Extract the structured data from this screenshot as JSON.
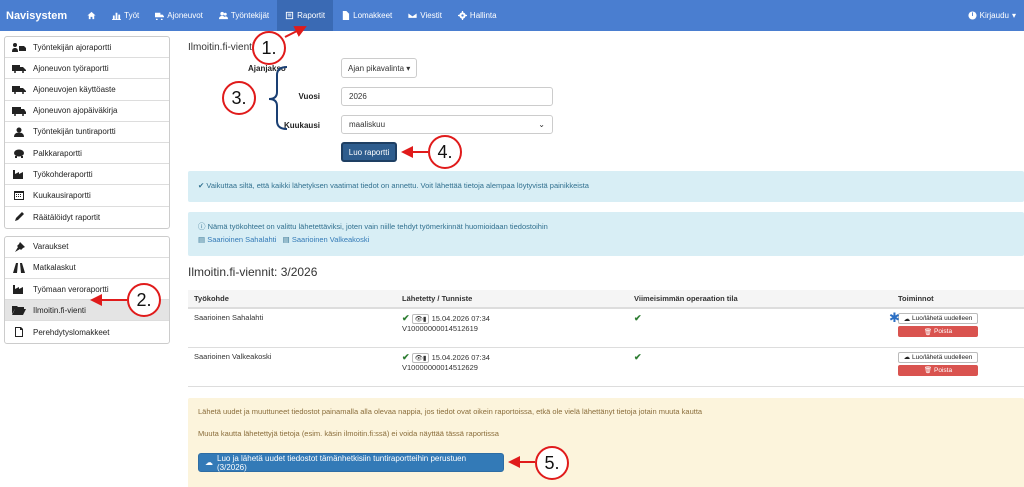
{
  "navbar": {
    "brand": "Navisystem",
    "items": [
      {
        "label": "",
        "icon": "home-icon"
      },
      {
        "label": "Työt",
        "icon": "bar-chart-icon"
      },
      {
        "label": "Ajoneuvot",
        "icon": "truck-icon"
      },
      {
        "label": "Työntekijät",
        "icon": "users-icon"
      },
      {
        "label": "Raportit",
        "icon": "report-icon",
        "active": true
      },
      {
        "label": "Lomakkeet",
        "icon": "file-icon"
      },
      {
        "label": "Viestit",
        "icon": "envelope-icon"
      },
      {
        "label": "Hallinta",
        "icon": "gear-icon"
      }
    ],
    "logout": "Kirjaudu"
  },
  "sidebar": {
    "group1": [
      {
        "label": "Työntekijän ajoraportti",
        "icon": "user-car-icon"
      },
      {
        "label": "Ajoneuvon työraportti",
        "icon": "truck-icon"
      },
      {
        "label": "Ajoneuvojen käyttöaste",
        "icon": "truck-icon"
      },
      {
        "label": "Ajoneuvon ajopäiväkirja",
        "icon": "truck-icon"
      },
      {
        "label": "Työntekijän tuntiraportti",
        "icon": "user-icon"
      },
      {
        "label": "Palkkaraportti",
        "icon": "piggy-bank-icon"
      },
      {
        "label": "Työkohderaportti",
        "icon": "factory-icon"
      },
      {
        "label": "Kuukausiraportti",
        "icon": "calendar-icon"
      },
      {
        "label": "Räätälöidyt raportit",
        "icon": "pencil-icon"
      }
    ],
    "group2": [
      {
        "label": "Varaukset",
        "icon": "pin-icon"
      },
      {
        "label": "Matkalaskut",
        "icon": "road-icon"
      },
      {
        "label": "Työmaan veroraportti",
        "icon": "factory-icon"
      },
      {
        "label": "Ilmoitin.fi-vienti",
        "icon": "folder-open-icon",
        "active": true
      },
      {
        "label": "Perehdytyslomakkeet",
        "icon": "document-icon"
      }
    ]
  },
  "main": {
    "title": "Ilmoitin.fi-vienti",
    "form": {
      "period_label": "Ajanjakso",
      "period_button": "Ajan pikavalinta",
      "year_label": "Vuosi",
      "year_value": "2026",
      "month_label": "Kuukausi",
      "month_value": "maaliskuu",
      "submit": "Luo raportti"
    },
    "alert_success": "Vaikuttaa siltä, että kaikki lähetyksen vaatimat tiedot on annettu. Voit lähettää tietoja alempaa löytyvistä painikkeista",
    "alert_info": {
      "text": "Nämä työkohteet on valittu lähetettäviksi, joten vain niille tehdyt työmerkinnät huomioidaan tiedostoihin",
      "links": [
        "Saarioinen Sahalahti",
        "Saarioinen Valkeakoski"
      ]
    },
    "section_title": "Ilmoitin.fi-viennit: 3/2026",
    "table": {
      "headers": [
        "Työkohde",
        "Lähetetty / Tunniste",
        "Viimeisimmän operaation tila",
        "Toiminnot"
      ],
      "rows": [
        {
          "site": "Saarioinen Sahalahti",
          "sent": "15.04.2026 07:34",
          "id": "V10000000014512619",
          "resend": "Luo/lähetä uudelleen",
          "delete": "Poista"
        },
        {
          "site": "Saarioinen Valkeakoski",
          "sent": "15.04.2026 07:34",
          "id": "V10000000014512629",
          "resend": "Luo/lähetä uudelleen",
          "delete": "Poista"
        }
      ]
    },
    "alert_warning": {
      "line1": "Lähetä uudet ja muuttuneet tiedostot painamalla alla olevaa nappia, jos tiedot ovat oikein raportoissa, etkä ole vielä lähettänyt tietoja jotain muuta kautta",
      "line2": "Muuta kautta lähetettyjä tietoja (esim. käsin ilmoitin.fi:ssä) ei voida näyttää tässä raportissa",
      "button": "Luo ja lähetä uudet tiedostot tämänhetkisiin tuntiraportteihin perustuen (3/2026)"
    }
  },
  "annotations": [
    "1.",
    "2.",
    "3.",
    "4.",
    "5."
  ],
  "colors": {
    "nav": "#4a7ed0",
    "nav_active": "#3a6ab4",
    "annotation": "#e01b1b",
    "primary": "#2e5d8e",
    "danger": "#d9534f"
  }
}
